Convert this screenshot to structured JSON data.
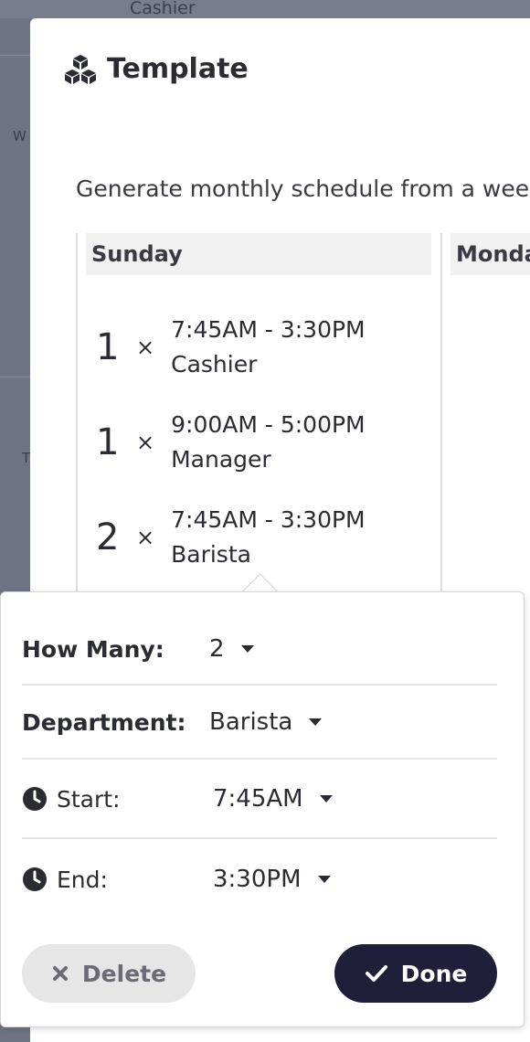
{
  "background": {
    "top_text": "Cashier",
    "side_letters": [
      "W",
      "T"
    ]
  },
  "modal": {
    "title": "Template",
    "title_icon": "cubes-icon",
    "subtitle": "Generate monthly schedule from a weekly template",
    "days": [
      {
        "name": "Sunday",
        "shifts": [
          {
            "count": "1",
            "times": "×",
            "time": "7:45AM - 3:30PM",
            "department": "Cashier"
          },
          {
            "count": "1",
            "times": "×",
            "time": "9:00AM - 5:00PM",
            "department": "Manager"
          },
          {
            "count": "2",
            "times": "×",
            "time": "7:45AM - 3:30PM",
            "department": "Barista"
          }
        ]
      },
      {
        "name": "Monday",
        "shifts": []
      }
    ]
  },
  "popover": {
    "how_many": {
      "label": "How Many:",
      "value": "2"
    },
    "department": {
      "label": "Department:",
      "value": "Barista"
    },
    "start": {
      "label": "Start:",
      "value": "7:45AM",
      "icon": "clock-icon"
    },
    "end": {
      "label": "End:",
      "value": "3:30PM",
      "icon": "clock-icon"
    },
    "delete_label": "Delete",
    "done_label": "Done"
  },
  "colors": {
    "overlay": "#6f7485",
    "done_button": "#1f1f3a",
    "delete_button": "#e6e6e6",
    "day_header": "#f1f1f1"
  }
}
